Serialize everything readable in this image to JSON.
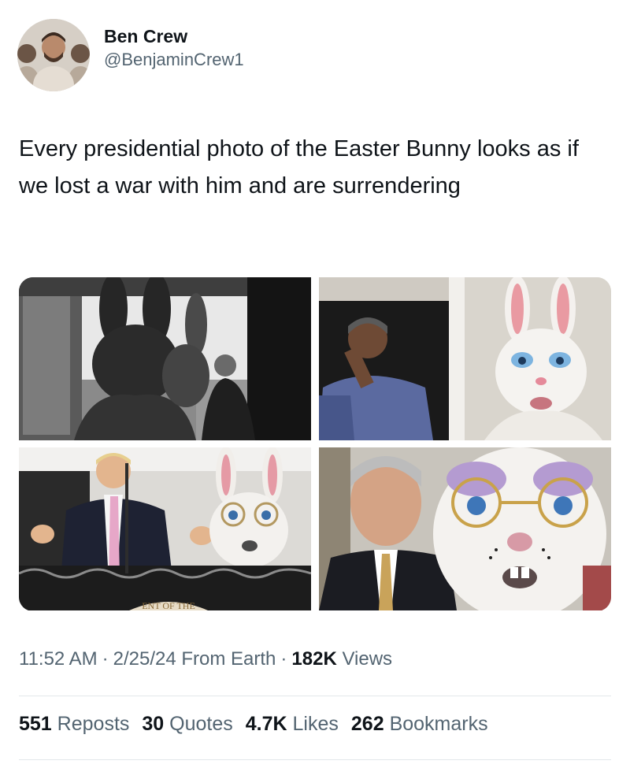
{
  "author": {
    "display_name": "Ben Crew",
    "handle": "@BenjaminCrew1",
    "avatar_icon": "avatar-photo"
  },
  "tweet": {
    "text": "Every presidential photo of the Easter Bunny looks as if we lost a war with him and are surrendering"
  },
  "media": {
    "photos": [
      {
        "name": "photo-bw-bunnies-balcony",
        "alt": ""
      },
      {
        "name": "photo-obama-bunny",
        "alt": ""
      },
      {
        "name": "photo-trump-bunny",
        "alt": ""
      },
      {
        "name": "photo-bush-bunny",
        "alt": ""
      }
    ],
    "seal_text": "ENT OF THE"
  },
  "meta": {
    "time": "11:52 AM",
    "dot1": "·",
    "date": "2/25/24",
    "source": "From Earth",
    "dot2": "·",
    "views_count": "182K",
    "views_label": "Views"
  },
  "stats": {
    "reposts_count": "551",
    "reposts_label": "Reposts",
    "quotes_count": "30",
    "quotes_label": "Quotes",
    "likes_count": "4.7K",
    "likes_label": "Likes",
    "bookmarks_count": "262",
    "bookmarks_label": "Bookmarks"
  },
  "colors": {
    "text": "#0f1419",
    "secondary": "#536471",
    "divider": "#e3e7ea"
  }
}
